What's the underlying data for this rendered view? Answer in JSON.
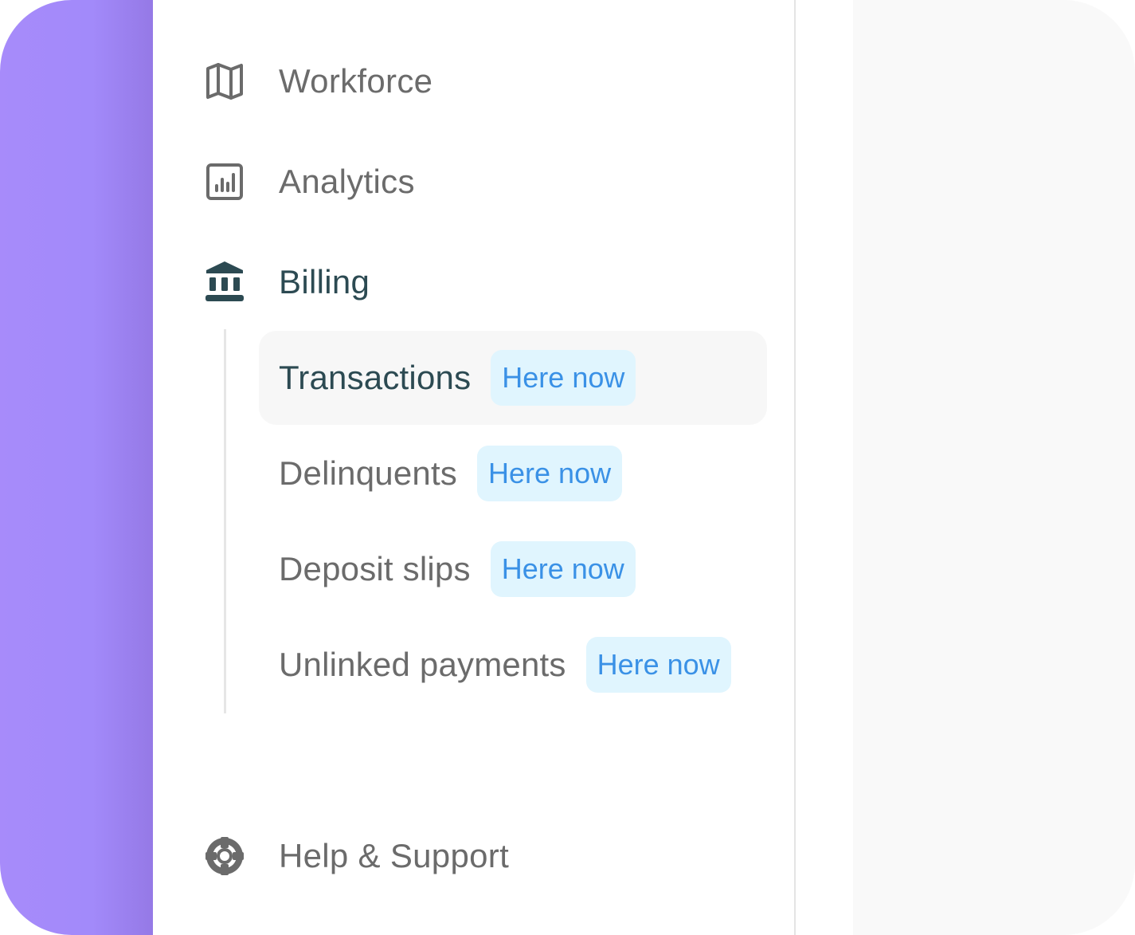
{
  "colors": {
    "accent": "#a78bfa",
    "active_text": "#2c4a52",
    "inactive_text": "#6b6b6b",
    "badge_bg": "#e0f5fe",
    "badge_text": "#3a91e6"
  },
  "nav": {
    "items": [
      {
        "label": "Workforce",
        "icon": "map-icon"
      },
      {
        "label": "Analytics",
        "icon": "bar-chart-icon"
      },
      {
        "label": "Billing",
        "icon": "bank-icon",
        "active": true
      }
    ],
    "billing_subitems": [
      {
        "label": "Transactions",
        "badge": "Here now",
        "selected": true
      },
      {
        "label": "Delinquents",
        "badge": "Here now"
      },
      {
        "label": "Deposit slips",
        "badge": "Here now"
      },
      {
        "label": "Unlinked payments",
        "badge": "Here now"
      }
    ],
    "footer": {
      "label": "Help & Support",
      "icon": "lifebuoy-icon"
    }
  }
}
